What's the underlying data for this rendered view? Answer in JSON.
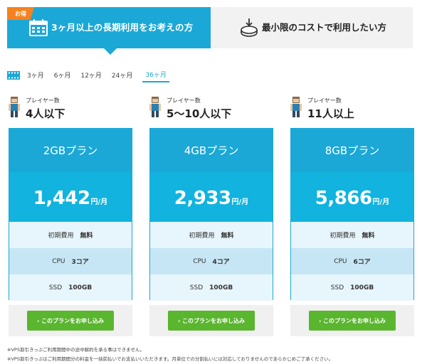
{
  "toggle": {
    "badge": "お得",
    "long_term_label": "3ヶ月以上の長期利用をお考えの方",
    "minimum_cost_label": "最小限のコストで利用したい方"
  },
  "periods": {
    "tabs": [
      "3ヶ月",
      "6ヶ月",
      "12ヶ月",
      "24ヶ月",
      "36ヶ月"
    ],
    "active": "36ヶ月"
  },
  "plans": [
    {
      "player_caption": "プレイヤー数",
      "player_count": "4人以下",
      "name": "2GBプラン",
      "price": "1,442",
      "price_unit": "円/月",
      "initial_fee_label": "初期費用",
      "initial_fee": "無料",
      "cpu_label": "CPU",
      "cpu": "3コア",
      "ssd_label": "SSD",
      "ssd": "100GB",
      "cta": "› このプランをお申し込み"
    },
    {
      "player_caption": "プレイヤー数",
      "player_count": "5〜10人以下",
      "name": "4GBプラン",
      "price": "2,933",
      "price_unit": "円/月",
      "initial_fee_label": "初期費用",
      "initial_fee": "無料",
      "cpu_label": "CPU",
      "cpu": "4コア",
      "ssd_label": "SSD",
      "ssd": "100GB",
      "cta": "› このプランをお申し込み"
    },
    {
      "player_caption": "プレイヤー数",
      "player_count": "11人以上",
      "name": "8GBプラン",
      "price": "5,866",
      "price_unit": "円/月",
      "initial_fee_label": "初期費用",
      "initial_fee": "無料",
      "cpu_label": "CPU",
      "cpu": "6コア",
      "ssd_label": "SSD",
      "ssd": "100GB",
      "cta": "› このプランをお申し込み"
    }
  ],
  "notes": [
    "※VPS割引きっぷご利用期間中の途中解約を承る事はできません。",
    "※VPS割引きっぷはご利用期間分の料金を一括前払いでお支払いいただきます。月単位での分割払いには対応しておりませんのであらかじめご了承ください。"
  ],
  "colors": {
    "accent": "#1ba8d6",
    "price_bg": "#12b3de",
    "badge": "#f5821f",
    "cta": "#5ab52f"
  }
}
